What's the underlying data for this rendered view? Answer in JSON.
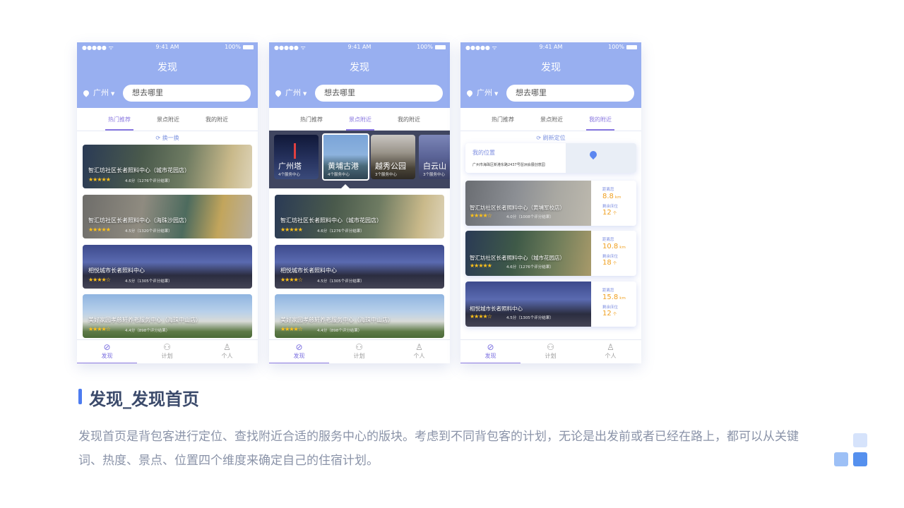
{
  "status_bar": {
    "signal": "●●●●● ᯤ",
    "time": "9:41 AM",
    "battery": "100%"
  },
  "header": {
    "title": "发现",
    "city": "广州",
    "search_placeholder": "想去哪里"
  },
  "tabs": [
    "热门推荐",
    "景点附近",
    "我的附近"
  ],
  "bottom_nav": [
    {
      "label": "发现",
      "icon": "compass-icon"
    },
    {
      "label": "计划",
      "icon": "users-icon"
    },
    {
      "label": "个人",
      "icon": "person-icon"
    }
  ],
  "screen1": {
    "refresh": "换一换",
    "cards": [
      {
        "name": "智汇坊社区长者照料中心（城市花园店）",
        "stars": "★★★★★",
        "score": "4.6分（1276个评分结果）"
      },
      {
        "name": "智汇坊社区长者照料中心（海珠沙园店）",
        "stars": "★★★★★",
        "score": "4.5分（1320个评分结果）"
      },
      {
        "name": "相悦城市长者照料中心",
        "stars": "★★★★☆",
        "score": "4.5分（1305个评分结果）"
      },
      {
        "name": "美好家园孝慈轩养老服务中心（海珠中山店）",
        "stars": "★★★★☆",
        "score": "4.4分（898个评分结果）"
      }
    ]
  },
  "screen2": {
    "spots": [
      {
        "name": "广州塔",
        "sub": "4个服务中心"
      },
      {
        "name": "黄埔古港",
        "sub": "4个服务中心"
      },
      {
        "name": "越秀公园",
        "sub": "3个服务中心"
      },
      {
        "name": "白云山",
        "sub": "3个服务中心"
      }
    ],
    "cards": [
      {
        "name": "智汇坊社区长者照料中心（城市花园店）",
        "stars": "★★★★★",
        "score": "4.6分（1276个评分结果）"
      },
      {
        "name": "相悦城市长者照料中心",
        "stars": "★★★★☆",
        "score": "4.5分（1305个评分结果）"
      },
      {
        "name": "美好家园孝慈轩养老服务中心（海珠中山店）",
        "stars": "★★★★☆",
        "score": "4.4分（898个评分结果）"
      }
    ]
  },
  "screen3": {
    "refresh": "刷新定位",
    "location_title": "我的位置",
    "address": "广州市海珠区新港东路2437号琶洲会展创意园",
    "distance_label": "距离您",
    "beds_label": "剩余床位",
    "km_unit": "km",
    "bed_unit": "个",
    "cards": [
      {
        "name": "智汇坊社区长者照料中心（黄埔军校店）",
        "stars": "★★★★☆",
        "score": "4.0分（1008个评分结果）",
        "distance": "8.8",
        "beds": "12"
      },
      {
        "name": "智汇坊社区长者照料中心（城市花园店）",
        "stars": "★★★★★",
        "score": "4.6分（1276个评分结果）",
        "distance": "10.8",
        "beds": "18"
      },
      {
        "name": "相悦城市长者照料中心",
        "stars": "★★★★☆",
        "score": "4.5分（1305个评分结果）",
        "distance": "15.8",
        "beds": "12"
      }
    ]
  },
  "section": {
    "title": "发现_发现首页",
    "description": "发现首页是背包客进行定位、查找附近合适的服务中心的版块。考虑到不同背包客的计划，无论是出发前或者已经在路上，都可以从关键词、热度、景点、位置四个维度来确定自己的住宿计划。"
  },
  "colors": {
    "header": "#98aff0",
    "accent": "#8a78e0",
    "bar": "#4d7cf0",
    "star": "#ffc21a",
    "distance": "#f0a020"
  }
}
